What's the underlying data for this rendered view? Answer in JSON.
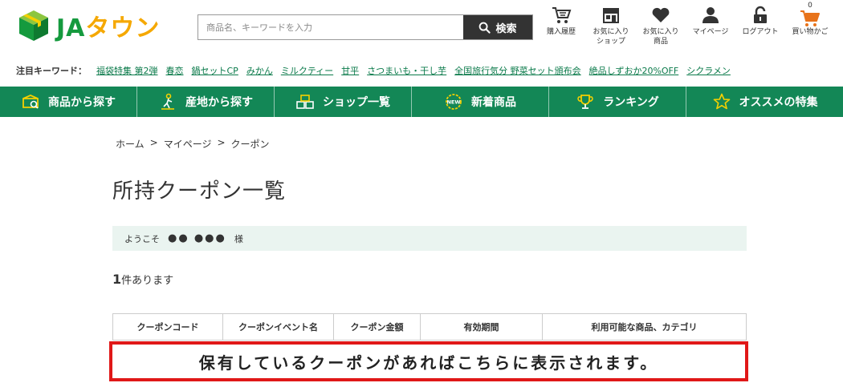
{
  "header": {
    "logo_ja": "JA",
    "logo_town": "タウン",
    "search_placeholder": "商品名、キーワードを入力",
    "search_button": "検索",
    "icons": [
      {
        "name": "purchase-history",
        "label": "購入履歴",
        "icon": "cart-list-icon"
      },
      {
        "name": "favorite-shop",
        "label": "お気に入り\nショップ",
        "icon": "shop-icon"
      },
      {
        "name": "favorite-product",
        "label": "お気に入り\n商品",
        "icon": "heart-icon"
      },
      {
        "name": "mypage",
        "label": "マイページ",
        "icon": "person-icon"
      },
      {
        "name": "logout",
        "label": "ログアウト",
        "icon": "lock-icon"
      },
      {
        "name": "cart",
        "label": "買い物かご",
        "icon": "cart-icon",
        "count": "0"
      }
    ]
  },
  "keywords": {
    "label": "注目キーワード：",
    "items": [
      "福袋特集 第2弾",
      "春恋",
      "鍋セットCP",
      "みかん",
      "ミルクティー",
      "甘平",
      "さつまいも・干し芋",
      "全国旅行気分 野菜セット頒布会",
      "絶品しずおか20%OFF",
      "シクラメン"
    ]
  },
  "nav": [
    {
      "label": "商品から探す",
      "icon": "box-icon"
    },
    {
      "label": "産地から探す",
      "icon": "farmer-icon"
    },
    {
      "label": "ショップ一覧",
      "icon": "shops-icon"
    },
    {
      "label": "新着商品",
      "icon": "new-badge-icon"
    },
    {
      "label": "ランキング",
      "icon": "trophy-icon"
    },
    {
      "label": "オススメの特集",
      "icon": "star-icon"
    }
  ],
  "breadcrumb": [
    "ホーム",
    "マイページ",
    "クーポン"
  ],
  "breadcrumb_sep": ">",
  "page_title": "所持クーポン一覧",
  "welcome": {
    "prefix": "ようこそ",
    "user": "●● ●●●",
    "suffix": "様"
  },
  "count": {
    "number": "1",
    "text": "件あります"
  },
  "table": {
    "headers": [
      "クーポンコード",
      "クーポンイベント名",
      "クーポン金額",
      "有効期間",
      "利用可能な商品、カテゴリ"
    ]
  },
  "notice": "保有しているクーポンがあればこちらに表示されます。",
  "colors": {
    "brand_green": "#138756",
    "logo_green": "#159a3e",
    "logo_yellow": "#f5a800",
    "cart_orange": "#e8731a",
    "notice_red": "#e01818"
  }
}
